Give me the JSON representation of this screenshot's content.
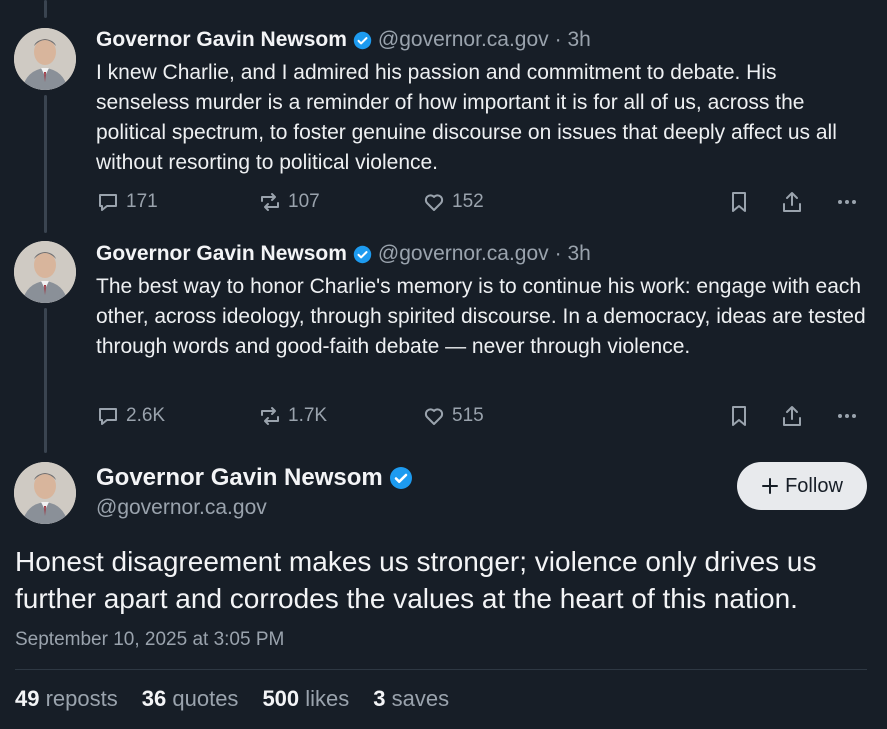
{
  "tweets": [
    {
      "author_name": "Governor Gavin Newsom",
      "handle": "@governor.ca.gov",
      "time": "· 3h",
      "text": "I knew Charlie, and I admired his passion and commitment to debate. His senseless murder is a reminder of how important it is for all of us, across the political spectrum, to foster genuine discourse on issues that deeply affect us all without resorting to political violence.",
      "replies": "171",
      "reposts": "107",
      "likes": "152"
    },
    {
      "author_name": "Governor Gavin Newsom",
      "handle": "@governor.ca.gov",
      "time": "· 3h",
      "text": "The best way to honor Charlie's memory is to continue his work: engage with each other, across ideology, through spirited discourse. In a democracy, ideas are tested through words and good-faith debate — never through violence.",
      "replies": "2.6K",
      "reposts": "1.7K",
      "likes": "515"
    }
  ],
  "main": {
    "author_name": "Governor Gavin Newsom",
    "handle": "@governor.ca.gov",
    "follow_label": "Follow",
    "text": "Honest disagreement makes us stronger; violence only drives us further apart and corrodes the values at the heart of this nation.",
    "timestamp": "September 10, 2025 at 3:05 PM",
    "stats": {
      "reposts_count": "49",
      "reposts_label": "reposts",
      "quotes_count": "36",
      "quotes_label": "quotes",
      "likes_count": "500",
      "likes_label": "likes",
      "saves_count": "3",
      "saves_label": "saves"
    }
  },
  "colors": {
    "background": "#171e27",
    "verified": "#1d9bf0",
    "muted": "#9aa3ad"
  }
}
